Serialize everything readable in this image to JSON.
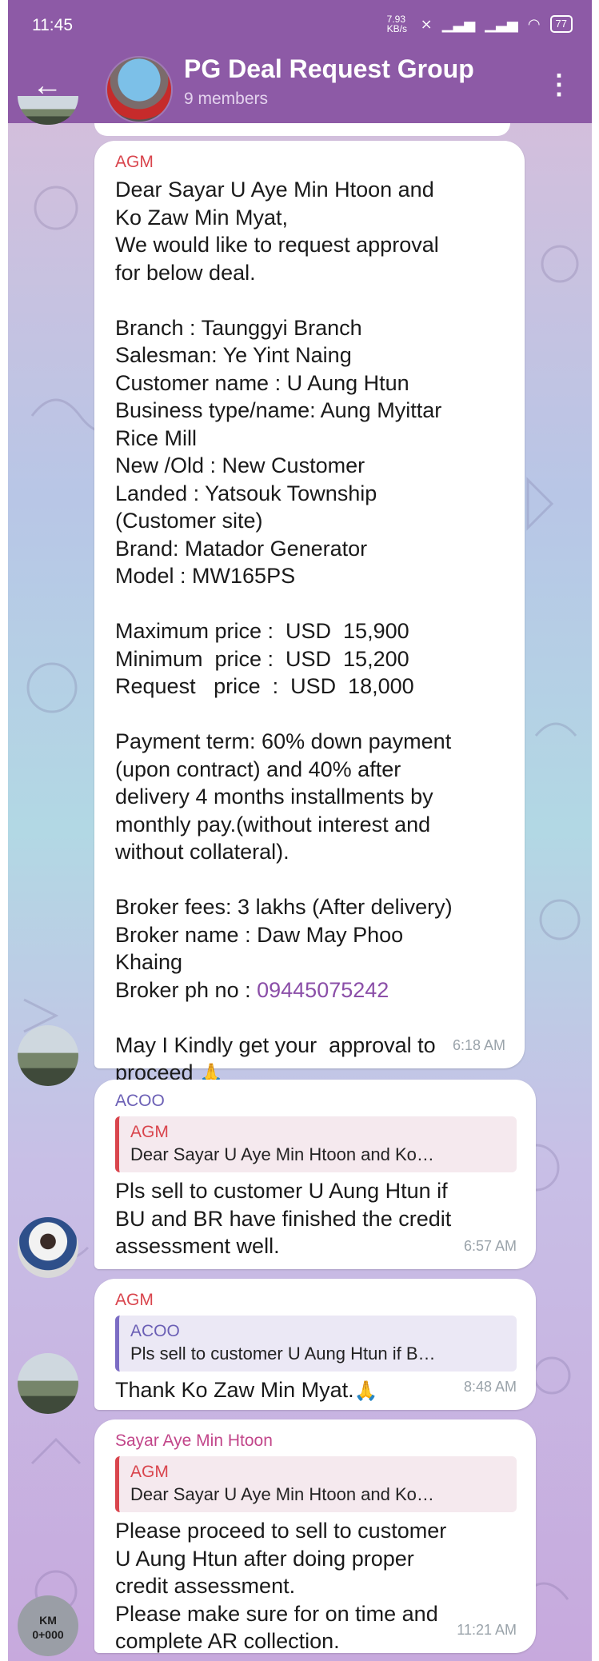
{
  "status_bar": {
    "time": "11:45",
    "net_speed": "7.93 KB/s",
    "battery": "77"
  },
  "header": {
    "title": "PG Deal Request Group",
    "subtitle": "9 members"
  },
  "messages": [
    {
      "sender": "AGM",
      "sender_color": "#d9454d",
      "body": "Dear Sayar U Aye Min Htoon and\nKo Zaw Min Myat,\nWe would like to request approval\nfor below deal.\n\nBranch : Taunggyi Branch\nSalesman: Ye Yint Naing\nCustomer name : U Aung Htun\nBusiness type/name: Aung Myittar\nRice Mill\nNew /Old : New Customer\nLanded : Yatsouk Township\n(Customer site)\nBrand: Matador Generator\nModel : MW165PS\n\nMaximum price :  USD  15,900\nMinimum  price :  USD  15,200\nRequest   price  :  USD  18,000\n\nPayment term: 60% down payment\n(upon contract) and 40% after\ndelivery 4 months installments by\nmonthly pay.(without interest and\nwithout collateral).\n\nBroker fees: 3 lakhs (After delivery)\nBroker name : Daw May Phoo\nKhaing\nBroker ph no : ",
      "phone": "09445075242",
      "closing": "May I Kindly get your  approval to\nproceed ",
      "emoji": "🙏",
      "time": "6:18 AM"
    },
    {
      "sender": "ACOO",
      "sender_color": "#6b5fb5",
      "reply_sender": "AGM",
      "reply_text": "Dear Sayar U Aye Min Htoon and Ko…",
      "body": "Pls sell to customer U Aung Htun if\nBU and BR have finished the credit\nassessment well.",
      "time": "6:57 AM"
    },
    {
      "sender": "AGM",
      "sender_color": "#d9454d",
      "reply_sender": "ACOO",
      "reply_text": "Pls sell to customer U Aung Htun if B…",
      "body": "Thank Ko Zaw Min Myat.",
      "emoji": "🙏",
      "time": "8:48 AM"
    },
    {
      "sender": "Sayar Aye Min Htoon",
      "sender_color": "#c2468a",
      "reply_sender": "AGM",
      "reply_text": "Dear Sayar U Aye Min Htoon and Ko…",
      "body": "Please proceed to sell to customer\nU Aung Htun after doing proper\ncredit assessment.\nPlease make sure for on time and\ncomplete AR collection.",
      "time": "11:21 AM"
    }
  ],
  "avatar_km_text": "KM\n0+000"
}
